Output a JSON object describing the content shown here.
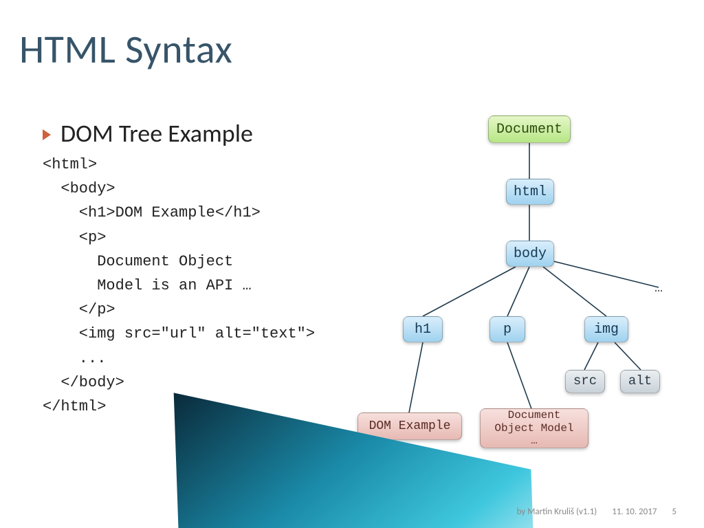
{
  "title": "HTML Syntax",
  "bullet": "DOM Tree Example",
  "code": "<html>\n  <body>\n    <h1>DOM Example</h1>\n    <p>\n      Document Object\n      Model is an API …\n    </p>\n    <img src=\"url\" alt=\"text\">\n    ...\n  </body>\n</html>",
  "tree": {
    "document": "Document",
    "html": "html",
    "body": "body",
    "h1": "h1",
    "p": "p",
    "img": "img",
    "src": "src",
    "alt": "alt",
    "h1_text": "DOM Example",
    "p_text": "Document\nObject Model\n…",
    "ellipsis": "…"
  },
  "footer": {
    "author": "by Martin Kruliš (v1.1)",
    "date": "11. 10. 2017",
    "page": "5"
  },
  "chart_data": {
    "type": "tree",
    "title": "DOM Tree Example",
    "root": "Document",
    "edges": [
      [
        "Document",
        "html"
      ],
      [
        "html",
        "body"
      ],
      [
        "body",
        "h1"
      ],
      [
        "body",
        "p"
      ],
      [
        "body",
        "img"
      ],
      [
        "body",
        "…"
      ],
      [
        "h1",
        "DOM Example"
      ],
      [
        "p",
        "Document Object Model …"
      ],
      [
        "img",
        "src"
      ],
      [
        "img",
        "alt"
      ]
    ],
    "node_styles": {
      "Document": "green",
      "html": "blue",
      "body": "blue",
      "h1": "blue",
      "p": "blue",
      "img": "blue",
      "src": "gray",
      "alt": "gray",
      "DOM Example": "pink",
      "Document Object Model …": "pink"
    }
  }
}
